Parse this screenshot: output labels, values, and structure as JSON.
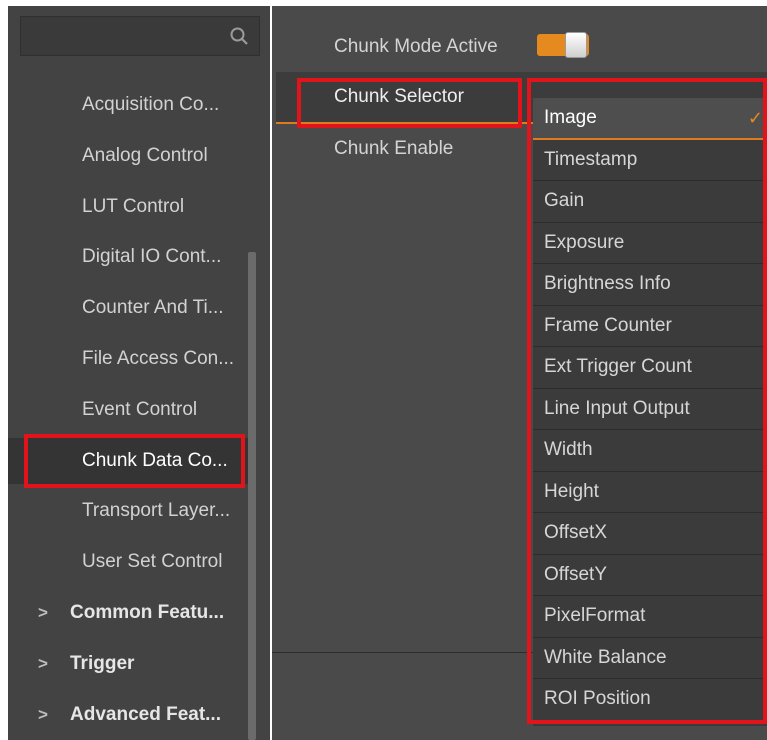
{
  "sidebar": {
    "search": {
      "placeholder": "",
      "icon": "search-icon"
    },
    "items": [
      {
        "label": "Acquisition Co...",
        "type": "item"
      },
      {
        "label": "Analog Control",
        "type": "item"
      },
      {
        "label": "LUT Control",
        "type": "item"
      },
      {
        "label": "Digital IO Cont...",
        "type": "item"
      },
      {
        "label": "Counter And Ti...",
        "type": "item"
      },
      {
        "label": "File Access Con...",
        "type": "item"
      },
      {
        "label": "Event Control",
        "type": "item"
      },
      {
        "label": "Chunk Data Co...",
        "type": "item",
        "selected": true
      },
      {
        "label": "Transport Layer...",
        "type": "item"
      },
      {
        "label": "User Set Control",
        "type": "item"
      },
      {
        "label": "Common Featu...",
        "type": "group",
        "chevron": ">"
      },
      {
        "label": "Trigger",
        "type": "group",
        "chevron": ">"
      },
      {
        "label": "Advanced Feat...",
        "type": "group",
        "chevron": ">"
      }
    ]
  },
  "properties": {
    "chunk_mode_active": {
      "label": "Chunk Mode Active",
      "value": true
    },
    "chunk_selector": {
      "label": "Chunk Selector"
    },
    "chunk_enable": {
      "label": "Chunk Enable"
    }
  },
  "dropdown": {
    "selected": "Image",
    "check_glyph": "✓",
    "options": [
      "Image",
      "Timestamp",
      "Gain",
      "Exposure",
      "Brightness Info",
      "Frame Counter",
      "Ext Trigger Count",
      "Line Input Output",
      "Width",
      "Height",
      "OffsetX",
      "OffsetY",
      "PixelFormat",
      "White Balance",
      "ROI Position"
    ]
  },
  "colors": {
    "accent": "#e58a1f",
    "highlight": "#e0141a",
    "sidebar_bg": "#434343",
    "panel_bg": "#4a4a4a"
  }
}
